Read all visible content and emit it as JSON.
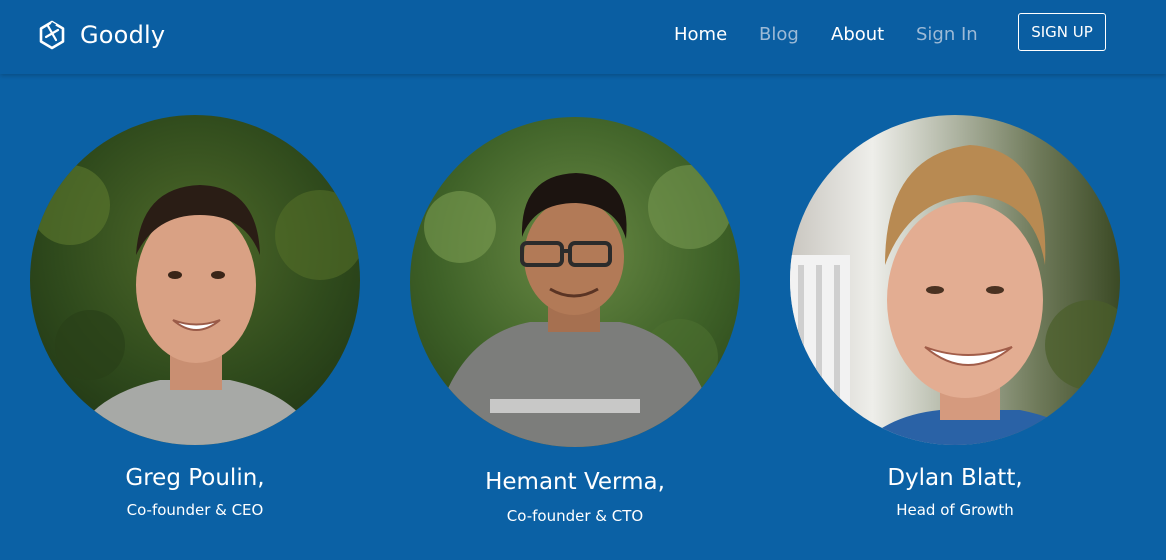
{
  "brand": {
    "name": "Goodly",
    "logo_icon": "hexagon-logo-icon"
  },
  "nav": {
    "items": [
      {
        "label": "Home",
        "state": "active"
      },
      {
        "label": "Blog",
        "state": "muted"
      },
      {
        "label": "About",
        "state": "active"
      },
      {
        "label": "Sign In",
        "state": "muted"
      }
    ],
    "signup_label": "SIGN UP"
  },
  "colors": {
    "background": "#0b61a5",
    "navbar": "#0a5ea2",
    "text": "#ffffff",
    "nav_muted": "#9dbad6"
  },
  "team": [
    {
      "name": "Greg Poulin,",
      "role": "Co-founder & CEO",
      "photo": "greg-poulin-photo"
    },
    {
      "name": "Hemant Verma,",
      "role": "Co-founder & CTO",
      "photo": "hemant-verma-photo"
    },
    {
      "name": "Dylan Blatt,",
      "role": "Head of Growth",
      "photo": "dylan-blatt-photo"
    }
  ]
}
